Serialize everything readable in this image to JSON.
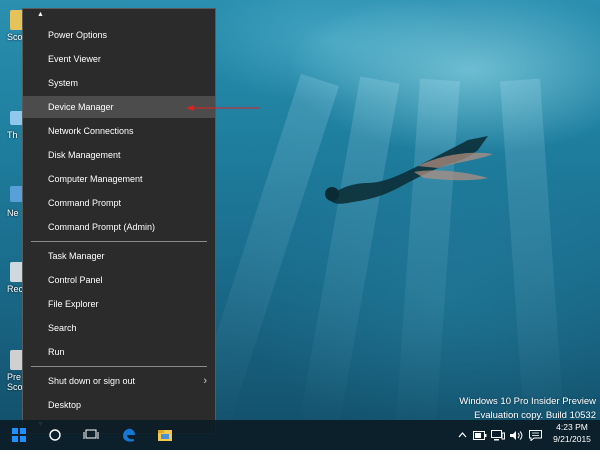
{
  "menu": {
    "items": [
      {
        "label": "Power Options"
      },
      {
        "label": "Event Viewer"
      },
      {
        "label": "System"
      },
      {
        "label": "Device Manager"
      },
      {
        "label": "Network Connections"
      },
      {
        "label": "Disk Management"
      },
      {
        "label": "Computer Management"
      },
      {
        "label": "Command Prompt"
      },
      {
        "label": "Command Prompt (Admin)"
      },
      {
        "label": "Task Manager"
      },
      {
        "label": "Control Panel"
      },
      {
        "label": "File Explorer"
      },
      {
        "label": "Search"
      },
      {
        "label": "Run"
      },
      {
        "label": "Shut down or sign out",
        "has_submenu": true
      },
      {
        "label": "Desktop"
      }
    ],
    "highlighted_item": "Device Manager",
    "scroll_up_glyph": "▲",
    "scroll_down_glyph": "▼",
    "submenu_chevron_glyph": "›",
    "annotation_arrow_color": "#e02020"
  },
  "desktop_icons": [
    {
      "label": "Sco",
      "icon": "folder-icon"
    },
    {
      "label": "Th",
      "icon": "this-pc-icon"
    },
    {
      "label": "Ne",
      "icon": "network-icon"
    },
    {
      "label": "Rec",
      "icon": "recycle-bin-icon"
    },
    {
      "label": "Pre\nSco",
      "icon": "file-icon"
    }
  ],
  "watermark": {
    "line1": "Windows 10 Pro Insider Preview",
    "line2": "Evaluation copy. Build 10532"
  },
  "taskbar": {
    "clock_time": "4:23 PM",
    "clock_date": "9/21/2015",
    "icons": [
      "start-icon",
      "search-icon",
      "task-view-icon",
      "edge-icon",
      "file-explorer-icon"
    ],
    "tray_icons": [
      "show-hidden-icons-chevron",
      "battery-icon",
      "network-icon",
      "volume-icon",
      "action-center-icon"
    ]
  },
  "colors": {
    "menu_bg": "#2b2b2b",
    "menu_highlight": "#4c4c4c",
    "taskbar_bg": "#0c1c26",
    "start_blue": "#1e90ff",
    "edge_blue": "#1478d4"
  }
}
